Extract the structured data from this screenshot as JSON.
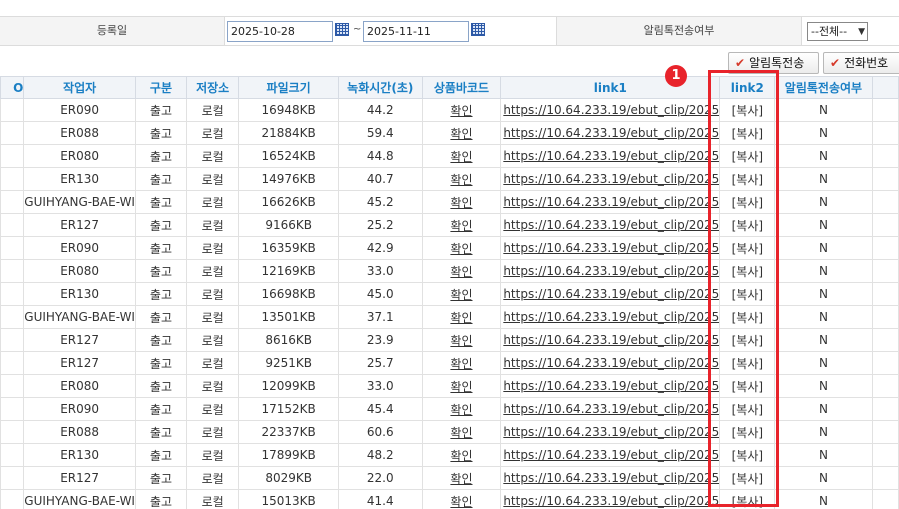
{
  "filter": {
    "reg_date_label": "등록일",
    "date_from": "2025-10-28",
    "date_sep": "~",
    "date_to": "2025-11-11",
    "alimtalk_label": "알림톡전송여부",
    "alimtalk_select": "--전체--"
  },
  "buttons": {
    "send_alimtalk": "알림톡전송",
    "phone_number": "전화번호"
  },
  "table": {
    "headers": [
      "O",
      "작업자",
      "구분",
      "저장소",
      "파일크기",
      "녹화시간(초)",
      "상품바코드",
      "link1",
      "link2",
      "알림톡전송여부"
    ],
    "rows": [
      {
        "author": "ER090",
        "type": "출고",
        "storage": "로컬",
        "size": "16948KB",
        "duration": "44.2",
        "barcode": "확인",
        "link1": "https://10.64.233.19/ebut_clip/2025",
        "link2": "[복사]",
        "sent": "N"
      },
      {
        "author": "ER088",
        "type": "출고",
        "storage": "로컬",
        "size": "21884KB",
        "duration": "59.4",
        "barcode": "확인",
        "link1": "https://10.64.233.19/ebut_clip/2025",
        "link2": "[복사]",
        "sent": "N"
      },
      {
        "author": "ER080",
        "type": "출고",
        "storage": "로컬",
        "size": "16524KB",
        "duration": "44.8",
        "barcode": "확인",
        "link1": "https://10.64.233.19/ebut_clip/2025",
        "link2": "[복사]",
        "sent": "N"
      },
      {
        "author": "ER130",
        "type": "출고",
        "storage": "로컬",
        "size": "14976KB",
        "duration": "40.7",
        "barcode": "확인",
        "link1": "https://10.64.233.19/ebut_clip/2025",
        "link2": "[복사]",
        "sent": "N"
      },
      {
        "author": "GUIHYANG-BAE-WI",
        "type": "출고",
        "storage": "로컬",
        "size": "16626KB",
        "duration": "45.2",
        "barcode": "확인",
        "link1": "https://10.64.233.19/ebut_clip/2025",
        "link2": "[복사]",
        "sent": "N"
      },
      {
        "author": "ER127",
        "type": "출고",
        "storage": "로컬",
        "size": "9166KB",
        "duration": "25.2",
        "barcode": "확인",
        "link1": "https://10.64.233.19/ebut_clip/2025",
        "link2": "[복사]",
        "sent": "N"
      },
      {
        "author": "ER090",
        "type": "출고",
        "storage": "로컬",
        "size": "16359KB",
        "duration": "42.9",
        "barcode": "확인",
        "link1": "https://10.64.233.19/ebut_clip/2025",
        "link2": "[복사]",
        "sent": "N"
      },
      {
        "author": "ER080",
        "type": "출고",
        "storage": "로컬",
        "size": "12169KB",
        "duration": "33.0",
        "barcode": "확인",
        "link1": "https://10.64.233.19/ebut_clip/2025",
        "link2": "[복사]",
        "sent": "N"
      },
      {
        "author": "ER130",
        "type": "출고",
        "storage": "로컬",
        "size": "16698KB",
        "duration": "45.0",
        "barcode": "확인",
        "link1": "https://10.64.233.19/ebut_clip/2025",
        "link2": "[복사]",
        "sent": "N"
      },
      {
        "author": "GUIHYANG-BAE-WI",
        "type": "출고",
        "storage": "로컬",
        "size": "13501KB",
        "duration": "37.1",
        "barcode": "확인",
        "link1": "https://10.64.233.19/ebut_clip/2025",
        "link2": "[복사]",
        "sent": "N"
      },
      {
        "author": "ER127",
        "type": "출고",
        "storage": "로컬",
        "size": "8616KB",
        "duration": "23.9",
        "barcode": "확인",
        "link1": "https://10.64.233.19/ebut_clip/2025",
        "link2": "[복사]",
        "sent": "N"
      },
      {
        "author": "ER127",
        "type": "출고",
        "storage": "로컬",
        "size": "9251KB",
        "duration": "25.7",
        "barcode": "확인",
        "link1": "https://10.64.233.19/ebut_clip/2025",
        "link2": "[복사]",
        "sent": "N"
      },
      {
        "author": "ER080",
        "type": "출고",
        "storage": "로컬",
        "size": "12099KB",
        "duration": "33.0",
        "barcode": "확인",
        "link1": "https://10.64.233.19/ebut_clip/2025",
        "link2": "[복사]",
        "sent": "N"
      },
      {
        "author": "ER090",
        "type": "출고",
        "storage": "로컬",
        "size": "17152KB",
        "duration": "45.4",
        "barcode": "확인",
        "link1": "https://10.64.233.19/ebut_clip/2025",
        "link2": "[복사]",
        "sent": "N"
      },
      {
        "author": "ER088",
        "type": "출고",
        "storage": "로컬",
        "size": "22337KB",
        "duration": "60.6",
        "barcode": "확인",
        "link1": "https://10.64.233.19/ebut_clip/2025",
        "link2": "[복사]",
        "sent": "N"
      },
      {
        "author": "ER130",
        "type": "출고",
        "storage": "로컬",
        "size": "17899KB",
        "duration": "48.2",
        "barcode": "확인",
        "link1": "https://10.64.233.19/ebut_clip/2025",
        "link2": "[복사]",
        "sent": "N"
      },
      {
        "author": "ER127",
        "type": "출고",
        "storage": "로컬",
        "size": "8029KB",
        "duration": "22.0",
        "barcode": "확인",
        "link1": "https://10.64.233.19/ebut_clip/2025",
        "link2": "[복사]",
        "sent": "N"
      },
      {
        "author": "GUIHYANG-BAE-WI",
        "type": "출고",
        "storage": "로컬",
        "size": "15013KB",
        "duration": "41.4",
        "barcode": "확인",
        "link1": "https://10.64.233.19/ebut_clip/2025",
        "link2": "[복사]",
        "sent": "N"
      }
    ]
  },
  "annotation": {
    "marker_number": "1",
    "highlight_color": "#e8232b"
  }
}
